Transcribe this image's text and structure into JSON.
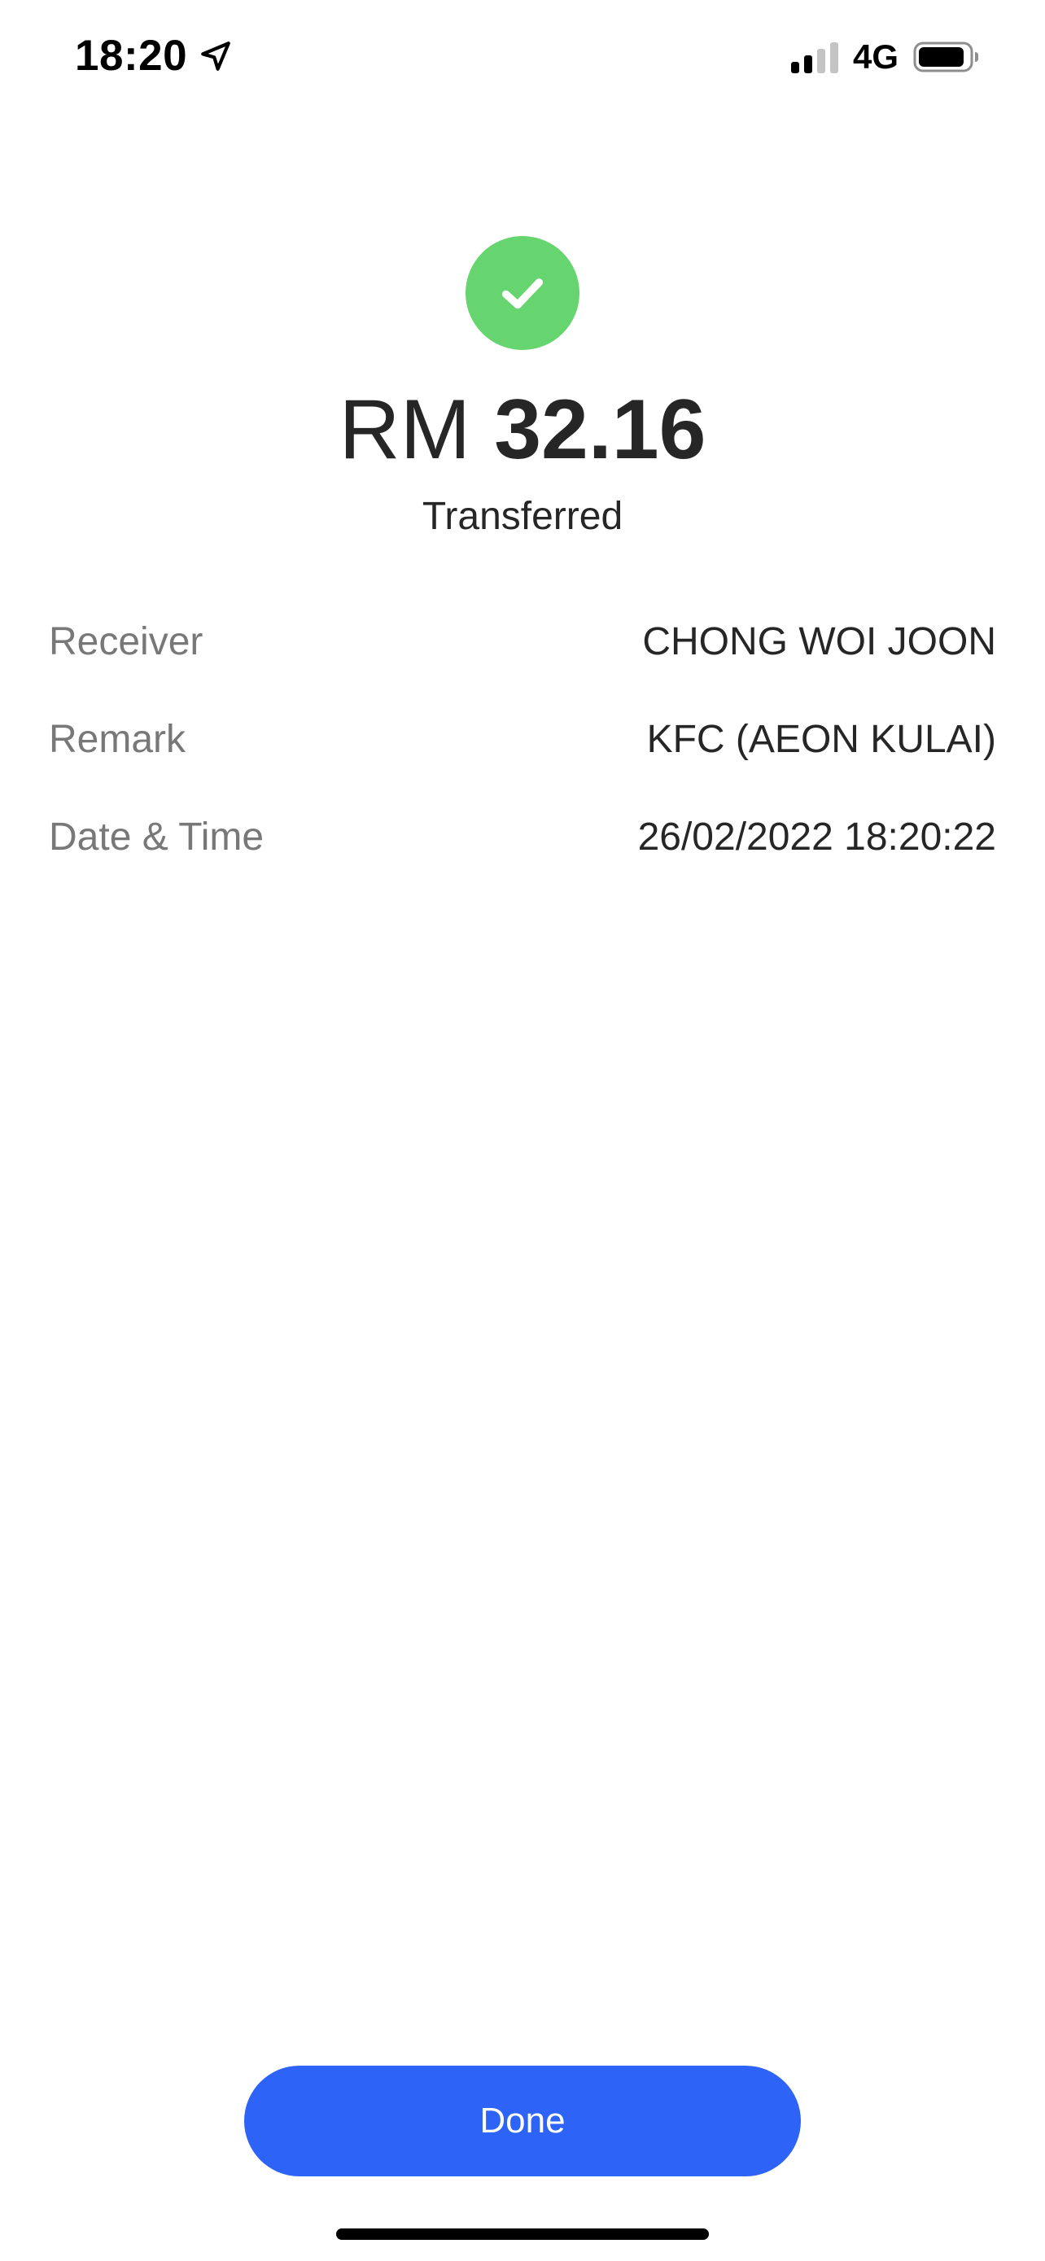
{
  "status_bar": {
    "time": "18:20",
    "location_icon": "location-arrow-icon",
    "signal_icon": "cellular-signal-icon",
    "network": "4G",
    "battery_icon": "battery-icon"
  },
  "result": {
    "icon": "checkmark-circle-icon",
    "success_color": "#66d56f",
    "currency": "RM",
    "amount": "32.16",
    "status": "Transferred"
  },
  "details": [
    {
      "label": "Receiver",
      "value": "CHONG WOI JOON"
    },
    {
      "label": "Remark",
      "value": "KFC (AEON KULAI)"
    },
    {
      "label": "Date & Time",
      "value": "26/02/2022 18:20:22"
    }
  ],
  "actions": {
    "done_label": "Done",
    "accent_color": "#2d63f6"
  }
}
